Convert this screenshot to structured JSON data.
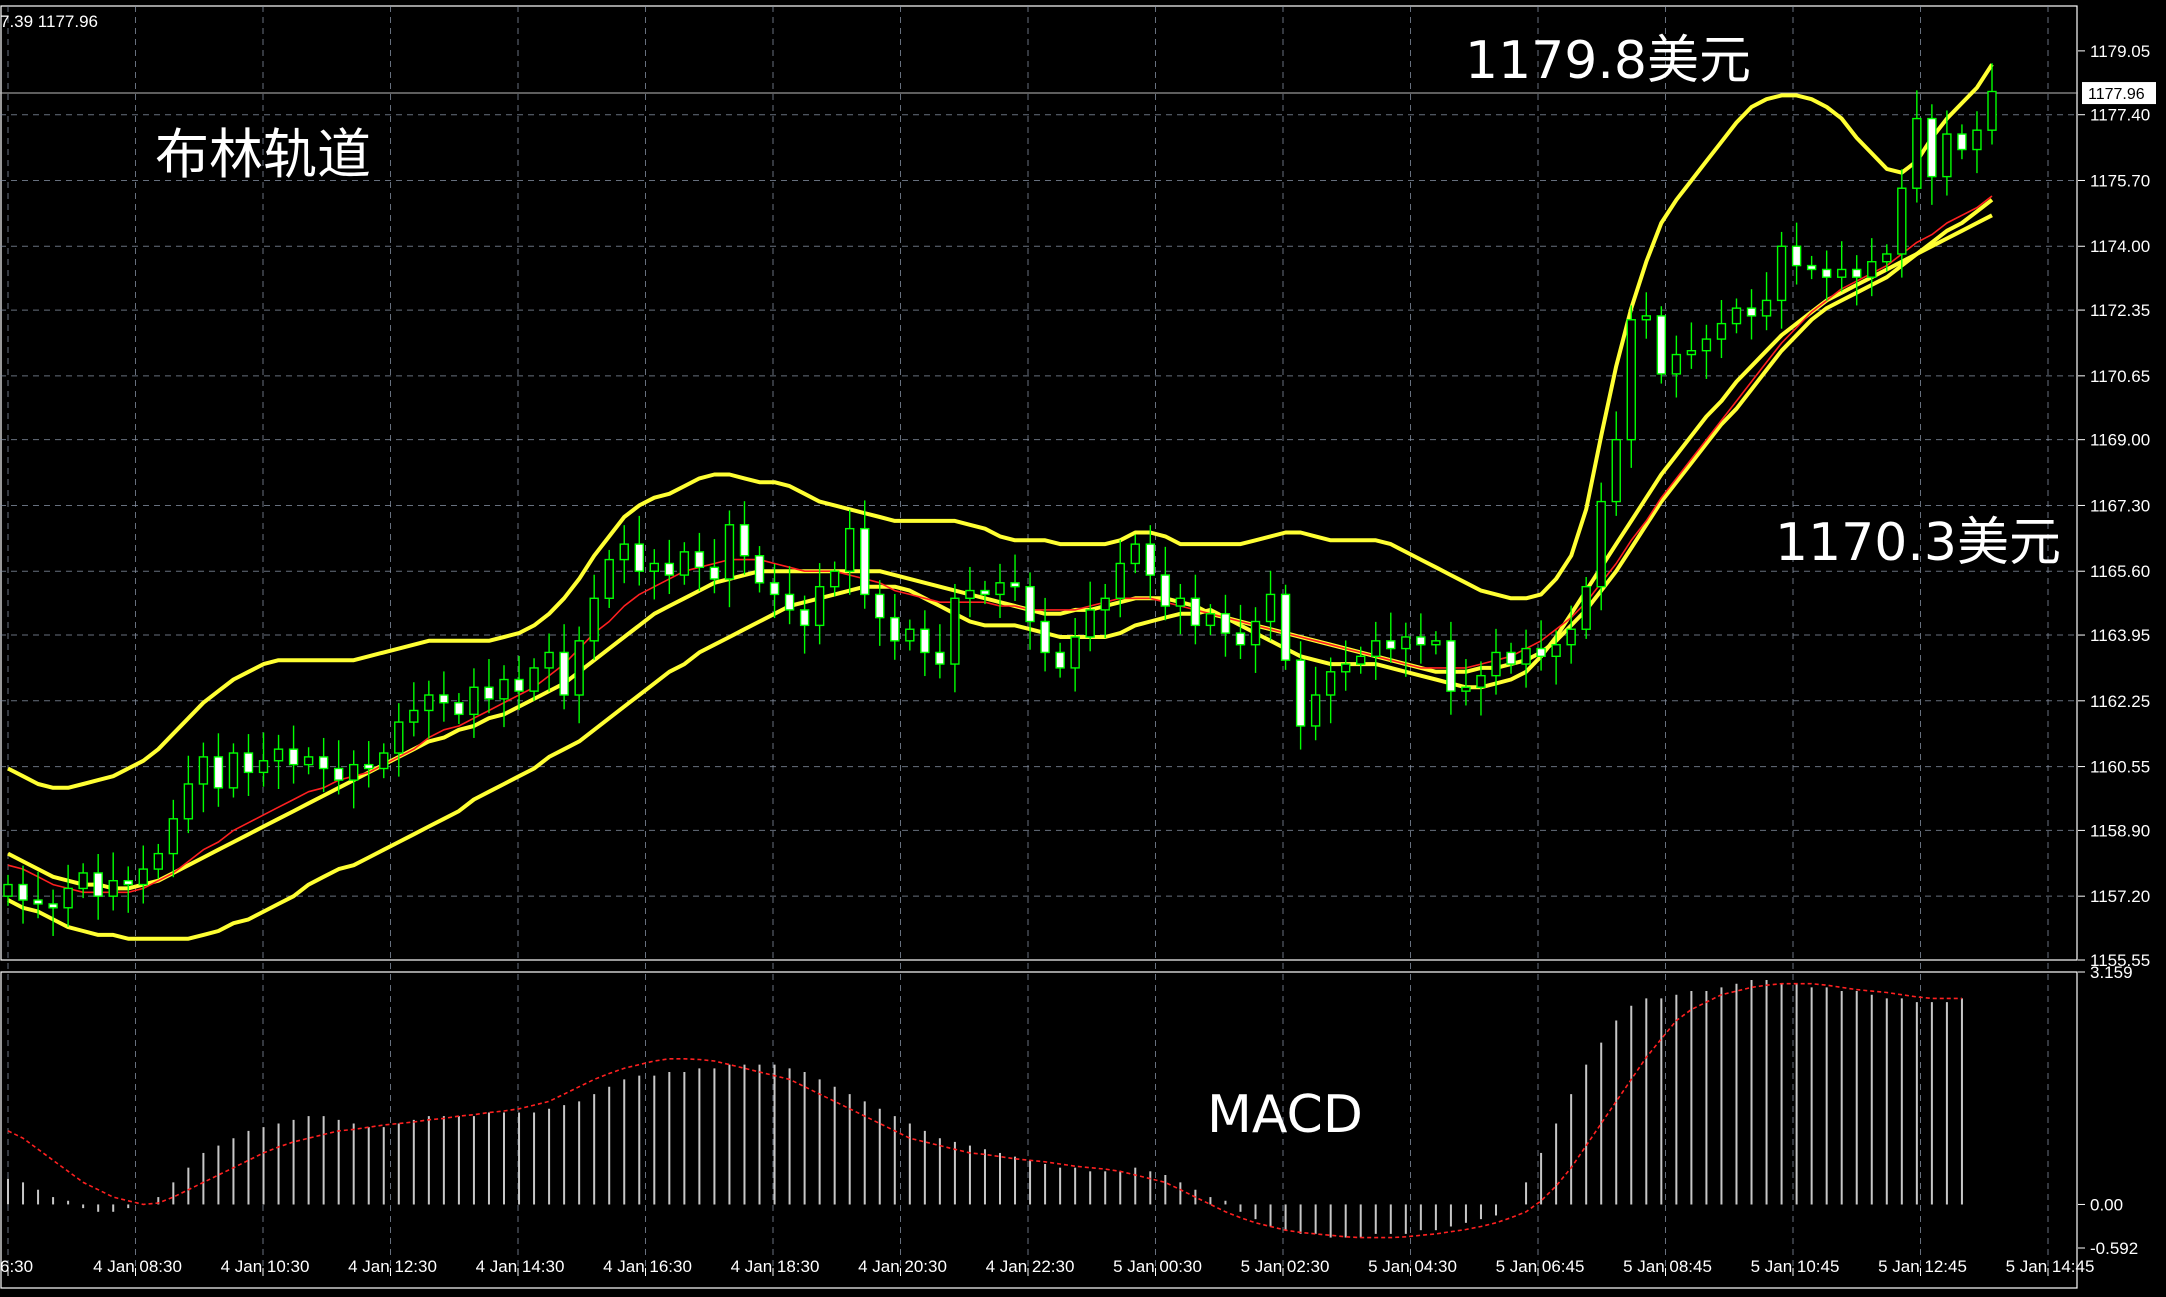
{
  "header": {
    "ohlc_text": "7.39 1177.96"
  },
  "annotations": {
    "bollinger_label": "布林轨道",
    "upper_price_label": "1179.8美元",
    "lower_price_label": "1170.3美元",
    "macd_label": "MACD"
  },
  "colors": {
    "background": "#000000",
    "grid": "#8a96a8",
    "bull_candle": "#00ff00",
    "bear_candle_body": "#ffffff",
    "bollinger": "#ffff33",
    "ma": "#ff2020",
    "axis_text": "#ffffff",
    "macd_hist": "#c8c8c8",
    "macd_signal": "#ff2020"
  },
  "chart_data": [
    {
      "type": "candlestick",
      "title": "布林轨道",
      "ylim": [
        1155.55,
        1179.9
      ],
      "y_ticks": [
        "1179.05",
        "1177.40",
        "1175.70",
        "1174.00",
        "1172.35",
        "1170.65",
        "1169.00",
        "1167.30",
        "1165.60",
        "1163.95",
        "1162.25",
        "1160.55",
        "1158.90",
        "1157.20",
        "1155.55"
      ],
      "current_price": "1177.96",
      "x_tick_labels": [
        "6:30",
        "4 Jan 08:30",
        "4 Jan 10:30",
        "4 Jan 12:30",
        "4 Jan 14:30",
        "4 Jan 16:30",
        "4 Jan 18:30",
        "4 Jan 20:30",
        "4 Jan 22:30",
        "5 Jan 00:30",
        "5 Jan 02:30",
        "5 Jan 04:30",
        "5 Jan 06:45",
        "5 Jan 08:45",
        "5 Jan 10:45",
        "5 Jan 12:45",
        "5 Jan 14:45"
      ],
      "closes": [
        1157.5,
        1157.1,
        1157.0,
        1156.9,
        1157.4,
        1157.8,
        1157.2,
        1157.6,
        1157.5,
        1157.9,
        1158.3,
        1159.2,
        1160.1,
        1160.8,
        1160.0,
        1160.9,
        1160.4,
        1160.7,
        1161.0,
        1160.6,
        1160.8,
        1160.5,
        1160.2,
        1160.6,
        1160.5,
        1160.9,
        1161.7,
        1162.0,
        1162.4,
        1162.2,
        1161.9,
        1162.6,
        1162.3,
        1162.8,
        1162.5,
        1163.1,
        1163.5,
        1162.4,
        1163.8,
        1164.9,
        1165.9,
        1166.3,
        1165.6,
        1165.8,
        1165.5,
        1166.1,
        1165.7,
        1165.4,
        1166.8,
        1166.0,
        1165.3,
        1165.0,
        1164.6,
        1164.2,
        1165.2,
        1165.6,
        1166.7,
        1165.0,
        1164.4,
        1163.8,
        1164.1,
        1163.5,
        1163.2,
        1164.9,
        1165.1,
        1165.0,
        1165.3,
        1165.2,
        1164.3,
        1163.5,
        1163.1,
        1163.9,
        1164.6,
        1164.9,
        1165.8,
        1166.3,
        1165.5,
        1164.7,
        1164.9,
        1164.2,
        1164.5,
        1164.0,
        1163.7,
        1164.3,
        1165.0,
        1163.3,
        1161.6,
        1162.4,
        1163.0,
        1163.2,
        1163.4,
        1163.8,
        1163.6,
        1163.9,
        1163.7,
        1163.8,
        1162.5,
        1162.6,
        1162.9,
        1163.5,
        1163.2,
        1163.6,
        1163.4,
        1163.7,
        1164.1,
        1165.2,
        1167.4,
        1169.0,
        1172.1,
        1172.2,
        1170.7,
        1171.2,
        1171.3,
        1171.6,
        1172.0,
        1172.4,
        1172.2,
        1172.6,
        1174.0,
        1173.5,
        1173.4,
        1173.2,
        1173.4,
        1173.2,
        1173.6,
        1173.8,
        1175.5,
        1177.3,
        1175.8,
        1176.9,
        1176.5,
        1177.0,
        1178.0
      ],
      "bollinger_upper": [
        1160.5,
        1160.3,
        1160.1,
        1160.0,
        1160.0,
        1160.1,
        1160.2,
        1160.3,
        1160.5,
        1160.7,
        1161.0,
        1161.4,
        1161.8,
        1162.2,
        1162.5,
        1162.8,
        1163.0,
        1163.2,
        1163.3,
        1163.3,
        1163.3,
        1163.3,
        1163.3,
        1163.3,
        1163.4,
        1163.5,
        1163.6,
        1163.7,
        1163.8,
        1163.8,
        1163.8,
        1163.8,
        1163.8,
        1163.9,
        1164.0,
        1164.2,
        1164.5,
        1164.9,
        1165.4,
        1166.0,
        1166.5,
        1167.0,
        1167.3,
        1167.5,
        1167.6,
        1167.8,
        1168.0,
        1168.1,
        1168.1,
        1168.0,
        1167.9,
        1167.9,
        1167.8,
        1167.6,
        1167.4,
        1167.3,
        1167.2,
        1167.1,
        1167.0,
        1166.9,
        1166.9,
        1166.9,
        1166.9,
        1166.9,
        1166.8,
        1166.7,
        1166.5,
        1166.4,
        1166.4,
        1166.4,
        1166.3,
        1166.3,
        1166.3,
        1166.3,
        1166.4,
        1166.6,
        1166.6,
        1166.5,
        1166.3,
        1166.3,
        1166.3,
        1166.3,
        1166.3,
        1166.4,
        1166.5,
        1166.6,
        1166.6,
        1166.5,
        1166.4,
        1166.4,
        1166.4,
        1166.4,
        1166.3,
        1166.1,
        1165.9,
        1165.7,
        1165.5,
        1165.3,
        1165.1,
        1165.0,
        1164.9,
        1164.9,
        1165.0,
        1165.4,
        1166.0,
        1167.2,
        1169.1,
        1170.9,
        1172.4,
        1173.6,
        1174.6,
        1175.2,
        1175.7,
        1176.2,
        1176.7,
        1177.2,
        1177.6,
        1177.8,
        1177.9,
        1177.9,
        1177.8,
        1177.6,
        1177.3,
        1176.8,
        1176.4,
        1176.0,
        1175.9,
        1176.2,
        1176.8,
        1177.3,
        1177.7,
        1178.1,
        1178.7
      ],
      "bollinger_middle": [
        1158.3,
        1158.1,
        1157.9,
        1157.7,
        1157.6,
        1157.5,
        1157.5,
        1157.4,
        1157.4,
        1157.5,
        1157.6,
        1157.8,
        1158.0,
        1158.2,
        1158.4,
        1158.6,
        1158.8,
        1159.0,
        1159.2,
        1159.4,
        1159.6,
        1159.8,
        1160.0,
        1160.2,
        1160.4,
        1160.6,
        1160.8,
        1161.0,
        1161.2,
        1161.3,
        1161.5,
        1161.6,
        1161.8,
        1161.9,
        1162.1,
        1162.3,
        1162.5,
        1162.7,
        1163.0,
        1163.3,
        1163.6,
        1163.9,
        1164.2,
        1164.5,
        1164.7,
        1164.9,
        1165.1,
        1165.3,
        1165.4,
        1165.5,
        1165.6,
        1165.6,
        1165.6,
        1165.6,
        1165.6,
        1165.6,
        1165.6,
        1165.6,
        1165.6,
        1165.5,
        1165.4,
        1165.3,
        1165.2,
        1165.1,
        1165.0,
        1164.9,
        1164.8,
        1164.7,
        1164.6,
        1164.5,
        1164.5,
        1164.6,
        1164.6,
        1164.7,
        1164.8,
        1164.9,
        1164.9,
        1164.9,
        1164.8,
        1164.7,
        1164.5,
        1164.4,
        1164.3,
        1164.2,
        1164.1,
        1164.0,
        1163.9,
        1163.8,
        1163.7,
        1163.6,
        1163.5,
        1163.4,
        1163.3,
        1163.2,
        1163.1,
        1163.0,
        1163.0,
        1163.0,
        1163.1,
        1163.1,
        1163.2,
        1163.3,
        1163.5,
        1163.8,
        1164.2,
        1164.6,
        1165.1,
        1165.6,
        1166.2,
        1166.8,
        1167.4,
        1167.9,
        1168.4,
        1168.9,
        1169.4,
        1169.8,
        1170.3,
        1170.8,
        1171.3,
        1171.7,
        1172.1,
        1172.4,
        1172.6,
        1172.8,
        1173.0,
        1173.2,
        1173.5,
        1173.8,
        1174.1,
        1174.4,
        1174.6,
        1174.9,
        1175.2
      ],
      "bollinger_lower": [
        1157.1,
        1156.9,
        1156.8,
        1156.6,
        1156.4,
        1156.3,
        1156.2,
        1156.2,
        1156.1,
        1156.1,
        1156.1,
        1156.1,
        1156.1,
        1156.2,
        1156.3,
        1156.5,
        1156.6,
        1156.8,
        1157.0,
        1157.2,
        1157.5,
        1157.7,
        1157.9,
        1158.0,
        1158.2,
        1158.4,
        1158.6,
        1158.8,
        1159.0,
        1159.2,
        1159.4,
        1159.7,
        1159.9,
        1160.1,
        1160.3,
        1160.5,
        1160.8,
        1161.0,
        1161.2,
        1161.5,
        1161.8,
        1162.1,
        1162.4,
        1162.7,
        1163.0,
        1163.2,
        1163.5,
        1163.7,
        1163.9,
        1164.1,
        1164.3,
        1164.5,
        1164.7,
        1164.8,
        1164.9,
        1165.0,
        1165.1,
        1165.2,
        1165.2,
        1165.2,
        1165.1,
        1164.9,
        1164.7,
        1164.5,
        1164.3,
        1164.2,
        1164.2,
        1164.2,
        1164.1,
        1164.0,
        1163.9,
        1163.9,
        1163.9,
        1163.9,
        1164.0,
        1164.2,
        1164.3,
        1164.4,
        1164.5,
        1164.5,
        1164.6,
        1164.4,
        1164.2,
        1164.0,
        1163.8,
        1163.6,
        1163.4,
        1163.3,
        1163.2,
        1163.2,
        1163.2,
        1163.2,
        1163.1,
        1163.0,
        1162.9,
        1162.8,
        1162.7,
        1162.6,
        1162.6,
        1162.7,
        1162.8,
        1163.0,
        1163.4,
        1163.9,
        1164.5,
        1165.1,
        1165.7,
        1166.3,
        1166.9,
        1167.5,
        1168.1,
        1168.6,
        1169.1,
        1169.6,
        1170.0,
        1170.5,
        1170.9,
        1171.3,
        1171.7,
        1172.0,
        1172.3,
        1172.6,
        1172.8,
        1173.0,
        1173.2,
        1173.4,
        1173.6,
        1173.8,
        1174.0,
        1174.2,
        1174.4,
        1174.6,
        1174.8
      ],
      "moving_average": [
        1158.0,
        1157.9,
        1157.7,
        1157.5,
        1157.4,
        1157.3,
        1157.3,
        1157.3,
        1157.3,
        1157.4,
        1157.6,
        1157.8,
        1158.1,
        1158.4,
        1158.6,
        1158.9,
        1159.1,
        1159.3,
        1159.5,
        1159.7,
        1159.9,
        1160.0,
        1160.2,
        1160.3,
        1160.4,
        1160.6,
        1160.8,
        1161.0,
        1161.3,
        1161.5,
        1161.6,
        1161.8,
        1162.0,
        1162.2,
        1162.4,
        1162.6,
        1162.9,
        1163.2,
        1163.6,
        1164.0,
        1164.3,
        1164.7,
        1165.0,
        1165.2,
        1165.4,
        1165.6,
        1165.7,
        1165.8,
        1165.9,
        1165.9,
        1165.9,
        1165.8,
        1165.7,
        1165.6,
        1165.6,
        1165.6,
        1165.5,
        1165.4,
        1165.3,
        1165.1,
        1165.0,
        1164.9,
        1164.8,
        1164.8,
        1164.8,
        1164.8,
        1164.7,
        1164.7,
        1164.6,
        1164.6,
        1164.6,
        1164.6,
        1164.7,
        1164.8,
        1164.9,
        1164.9,
        1164.9,
        1164.8,
        1164.7,
        1164.6,
        1164.5,
        1164.4,
        1164.3,
        1164.2,
        1164.1,
        1164.0,
        1163.9,
        1163.8,
        1163.7,
        1163.6,
        1163.5,
        1163.4,
        1163.3,
        1163.2,
        1163.1,
        1163.1,
        1163.1,
        1163.1,
        1163.2,
        1163.3,
        1163.4,
        1163.6,
        1163.8,
        1164.1,
        1164.4,
        1164.8,
        1165.3,
        1165.8,
        1166.4,
        1166.9,
        1167.5,
        1168.0,
        1168.5,
        1169.0,
        1169.5,
        1170.0,
        1170.5,
        1171.0,
        1171.5,
        1171.9,
        1172.3,
        1172.6,
        1172.9,
        1173.1,
        1173.3,
        1173.5,
        1173.8,
        1174.1,
        1174.3,
        1174.6,
        1174.8,
        1175.0,
        1175.3
      ]
    },
    {
      "type": "bar",
      "title": "MACD",
      "ylim": [
        -0.592,
        3.159
      ],
      "y_ticks": [
        "3.159",
        "0.00",
        "-0.592"
      ],
      "histogram": [
        0.35,
        0.3,
        0.2,
        0.1,
        0.05,
        -0.05,
        -0.1,
        -0.1,
        -0.05,
        0.0,
        0.1,
        0.3,
        0.5,
        0.7,
        0.8,
        0.9,
        1.0,
        1.05,
        1.1,
        1.15,
        1.2,
        1.2,
        1.15,
        1.1,
        1.05,
        1.05,
        1.1,
        1.15,
        1.2,
        1.2,
        1.2,
        1.2,
        1.25,
        1.25,
        1.25,
        1.25,
        1.3,
        1.35,
        1.4,
        1.5,
        1.6,
        1.7,
        1.75,
        1.75,
        1.8,
        1.8,
        1.85,
        1.85,
        1.9,
        1.9,
        1.9,
        1.9,
        1.85,
        1.8,
        1.7,
        1.6,
        1.5,
        1.4,
        1.3,
        1.2,
        1.1,
        1.0,
        0.9,
        0.85,
        0.8,
        0.75,
        0.7,
        0.65,
        0.6,
        0.55,
        0.5,
        0.5,
        0.45,
        0.45,
        0.45,
        0.5,
        0.45,
        0.4,
        0.3,
        0.2,
        0.1,
        0.05,
        -0.1,
        -0.2,
        -0.3,
        -0.35,
        -0.4,
        -0.4,
        -0.45,
        -0.45,
        -0.45,
        -0.4,
        -0.4,
        -0.4,
        -0.35,
        -0.35,
        -0.3,
        -0.25,
        -0.2,
        -0.15,
        0.0,
        0.3,
        0.7,
        1.1,
        1.5,
        1.9,
        2.2,
        2.5,
        2.7,
        2.8,
        2.8,
        2.85,
        2.9,
        2.9,
        2.95,
        3.0,
        3.05,
        3.05,
        3.0,
        3.0,
        2.95,
        2.95,
        2.9,
        2.9,
        2.85,
        2.8,
        2.8,
        2.75,
        2.75,
        2.75,
        2.8
      ],
      "signal": [
        1.0,
        0.9,
        0.75,
        0.6,
        0.45,
        0.3,
        0.2,
        0.1,
        0.05,
        0.0,
        0.02,
        0.1,
        0.2,
        0.3,
        0.4,
        0.5,
        0.6,
        0.7,
        0.78,
        0.85,
        0.9,
        0.95,
        1.0,
        1.02,
        1.05,
        1.08,
        1.1,
        1.12,
        1.15,
        1.17,
        1.2,
        1.22,
        1.25,
        1.27,
        1.3,
        1.35,
        1.4,
        1.5,
        1.6,
        1.7,
        1.78,
        1.85,
        1.9,
        1.95,
        1.98,
        1.98,
        1.97,
        1.95,
        1.9,
        1.85,
        1.8,
        1.75,
        1.7,
        1.6,
        1.5,
        1.4,
        1.3,
        1.2,
        1.1,
        1.0,
        0.9,
        0.85,
        0.8,
        0.75,
        0.7,
        0.68,
        0.65,
        0.62,
        0.6,
        0.58,
        0.55,
        0.52,
        0.5,
        0.48,
        0.45,
        0.4,
        0.35,
        0.3,
        0.2,
        0.1,
        0.0,
        -0.1,
        -0.18,
        -0.25,
        -0.3,
        -0.35,
        -0.38,
        -0.4,
        -0.42,
        -0.44,
        -0.45,
        -0.45,
        -0.45,
        -0.44,
        -0.42,
        -0.4,
        -0.37,
        -0.34,
        -0.3,
        -0.25,
        -0.18,
        -0.1,
        0.05,
        0.25,
        0.5,
        0.8,
        1.1,
        1.4,
        1.7,
        2.0,
        2.25,
        2.5,
        2.65,
        2.75,
        2.85,
        2.9,
        2.95,
        2.98,
        3.0,
        3.0,
        3.0,
        2.98,
        2.95,
        2.92,
        2.9,
        2.88,
        2.85,
        2.82,
        2.8,
        2.8,
        2.8
      ]
    }
  ]
}
